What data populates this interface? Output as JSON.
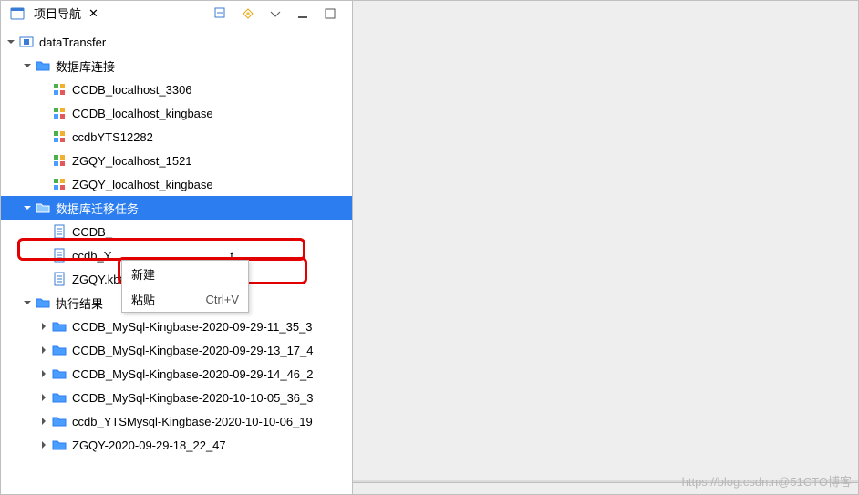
{
  "tab": {
    "title": "项目导航",
    "close_glyph": "✕"
  },
  "toolbar": {
    "icon1": "collapse-icon",
    "icon2": "link-icon",
    "icon3": "menu-dropdown-icon",
    "icon4": "minimize-icon",
    "icon5": "maximize-icon"
  },
  "tree": {
    "root": {
      "label": "dataTransfer"
    },
    "conn_folder": {
      "label": "数据库连接"
    },
    "conns": [
      {
        "label": "CCDB_localhost_3306"
      },
      {
        "label": "CCDB_localhost_kingbase"
      },
      {
        "label": "ccdbYTS12282"
      },
      {
        "label": "ZGQY_localhost_1521"
      },
      {
        "label": "ZGQY_localhost_kingbase"
      }
    ],
    "task_folder": {
      "label": "数据库迁移任务"
    },
    "tasks": [
      {
        "label": "CCDB_"
      },
      {
        "label": "ccdb_Y"
      },
      {
        "label": "ZGQY.kbt"
      }
    ],
    "task_suffix": "t",
    "result_folder": {
      "label": "执行结果"
    },
    "results": [
      {
        "label": "CCDB_MySql-Kingbase-2020-09-29-11_35_3"
      },
      {
        "label": "CCDB_MySql-Kingbase-2020-09-29-13_17_4"
      },
      {
        "label": "CCDB_MySql-Kingbase-2020-09-29-14_46_2"
      },
      {
        "label": "CCDB_MySql-Kingbase-2020-10-10-05_36_3"
      },
      {
        "label": "ccdb_YTSMysql-Kingbase-2020-10-10-06_19"
      },
      {
        "label": "ZGQY-2020-09-29-18_22_47"
      }
    ]
  },
  "context_menu": {
    "new": "新建",
    "paste": "粘贴",
    "paste_shortcut": "Ctrl+V"
  },
  "watermark": "https://blog.csdn.n@51CTO博客"
}
